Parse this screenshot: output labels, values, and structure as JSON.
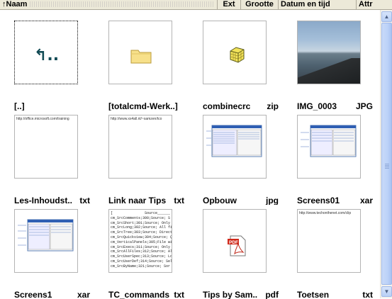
{
  "header": {
    "naam": "↑Naam",
    "ext": "Ext",
    "grootte": "Grootte",
    "datum": "Datum en tijd",
    "attr": "Attr"
  },
  "items": [
    {
      "name": "[..]",
      "ext": "",
      "preview": "updir-icon"
    },
    {
      "name": "[totalcmd-Werk..]",
      "ext": "",
      "preview": "folder-icon"
    },
    {
      "name": "combinecrc",
      "ext": "zip",
      "preview": "archive-icon"
    },
    {
      "name": "IMG_0003",
      "ext": "JPG",
      "preview": "photo-preview"
    },
    {
      "name": "Les-Inhoudst..",
      "ext": "txt",
      "preview": "text-preview",
      "url": "http://office.microsoft.com/training"
    },
    {
      "name": "Link naar Tips",
      "ext": "txt",
      "preview": "text-preview",
      "url": "http://www.xs4all.nl/~samzen/tco"
    },
    {
      "name": "Opbouw",
      "ext": "jpg",
      "preview": "screenshot-preview"
    },
    {
      "name": "Screens01",
      "ext": "xar",
      "preview": "screenshot-preview"
    },
    {
      "name": "Screens1",
      "ext": "xar",
      "preview": "screenshot-preview"
    },
    {
      "name": "TC_commands",
      "ext": "txt",
      "preview": "text-preview",
      "lines": "[               Source______\ncm_SrcComments;300;Source; S\ncm_SrcShort;301;Source; Only fi\ncm_SrcLong;302;Source; All file d\ncm_SrcTree;303;Source; Director\ncm_SrcQuickview;304;Source; Q\ncm_VerticalPanels;305;File windo\ncm_SrcExecs;311;Source; Only\ncm_SrcAllFiles;312;Source; All fi\ncm_SrcUserSpec;313;Source; Lo\ncm_SrcUserDef;314;Source; Sele\ncm_SrcByName;321;Source; Sor"
    },
    {
      "name": "Tips by Sam..",
      "ext": "pdf",
      "preview": "pdf-icon"
    },
    {
      "name": "Toetsen",
      "ext": "txt",
      "preview": "text-preview",
      "url": "http://www.techonthenet.com/clip"
    }
  ],
  "scrollbar": {
    "up": "▲",
    "down": "▼"
  }
}
